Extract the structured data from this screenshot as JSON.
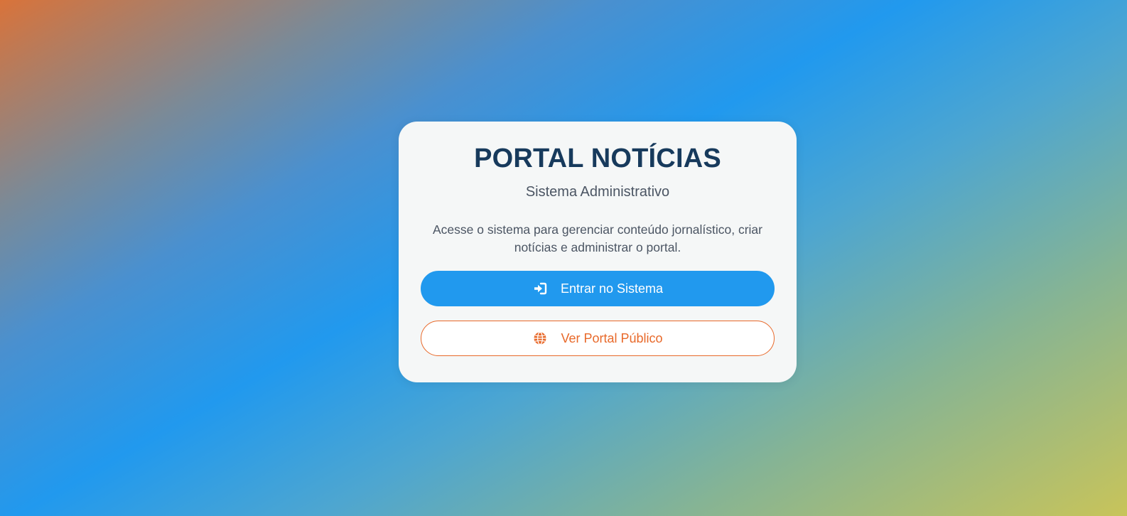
{
  "card": {
    "title": "PORTAL NOTÍCIAS",
    "subtitle": "Sistema Administrativo",
    "description": "Acesse o sistema para gerenciar conteúdo jornalístico, criar notícias e administrar o portal."
  },
  "buttons": {
    "login": {
      "label": "Entrar no Sistema",
      "icon": "sign-in-icon",
      "color": "#2199ee"
    },
    "public_portal": {
      "label": "Ver Portal Público",
      "icon": "globe-icon",
      "color": "#e8692a"
    }
  },
  "colors": {
    "title": "#173a5c",
    "card_background": "#f5f7f7",
    "gradient": [
      "#d9733a",
      "#2199ee",
      "#c8c45a"
    ]
  }
}
